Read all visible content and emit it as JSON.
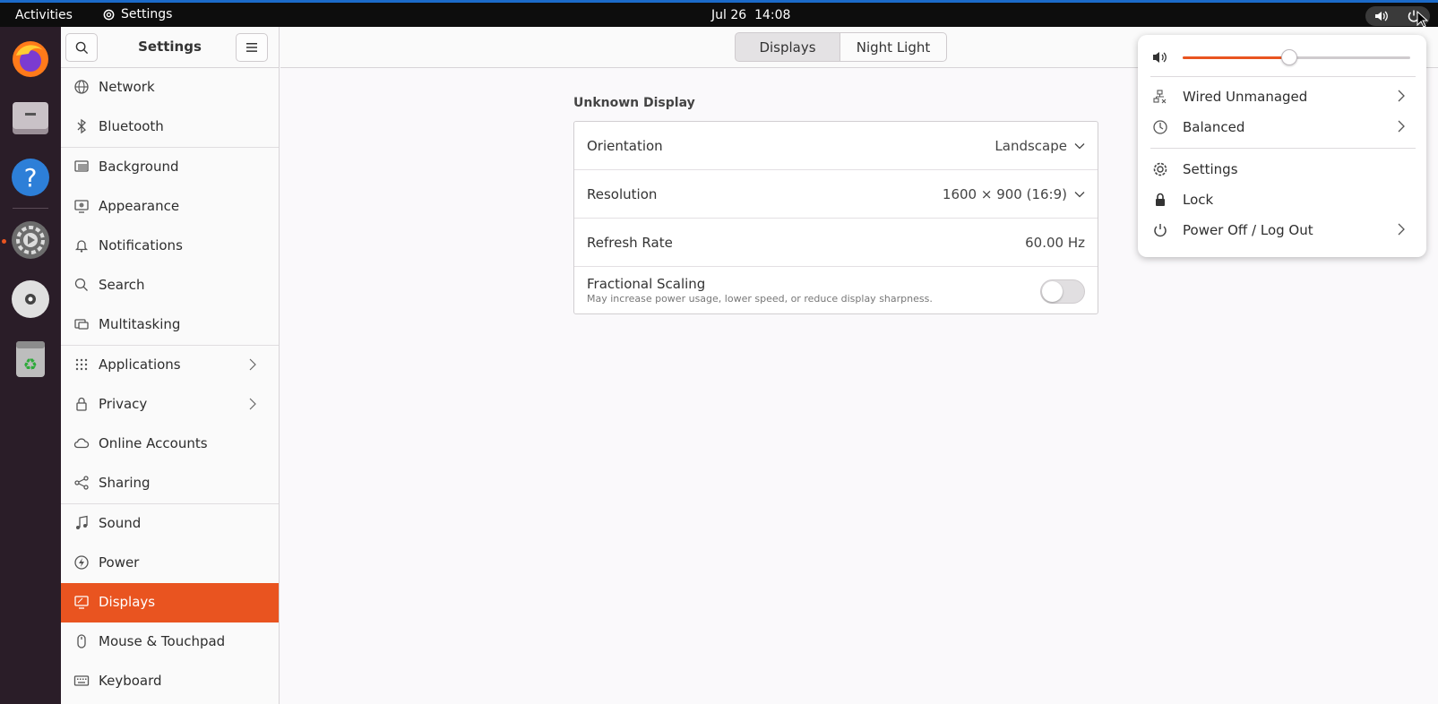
{
  "topbar": {
    "activities": "Activities",
    "app_name": "Settings",
    "date": "Jul 26",
    "time": "14:08"
  },
  "dock": {
    "items": [
      "firefox-icon",
      "files-icon",
      "help-icon",
      "settings-icon",
      "disc-icon",
      "trash-icon"
    ]
  },
  "sidebar": {
    "title": "Settings",
    "items": [
      {
        "label": "Network",
        "icon": "network-icon"
      },
      {
        "label": "Bluetooth",
        "icon": "bluetooth-icon"
      },
      {
        "label": "Background",
        "icon": "background-icon"
      },
      {
        "label": "Appearance",
        "icon": "appearance-icon"
      },
      {
        "label": "Notifications",
        "icon": "bell-icon"
      },
      {
        "label": "Search",
        "icon": "search-icon"
      },
      {
        "label": "Multitasking",
        "icon": "multitasking-icon"
      },
      {
        "label": "Applications",
        "icon": "grid-icon"
      },
      {
        "label": "Privacy",
        "icon": "lock-icon"
      },
      {
        "label": "Online Accounts",
        "icon": "cloud-icon"
      },
      {
        "label": "Sharing",
        "icon": "share-icon"
      },
      {
        "label": "Sound",
        "icon": "music-note-icon"
      },
      {
        "label": "Power",
        "icon": "power-bolt-icon"
      },
      {
        "label": "Displays",
        "icon": "display-icon",
        "active": true
      },
      {
        "label": "Mouse & Touchpad",
        "icon": "mouse-icon"
      },
      {
        "label": "Keyboard",
        "icon": "keyboard-icon"
      }
    ]
  },
  "tabs": {
    "displays": "Displays",
    "night_light": "Night Light"
  },
  "display": {
    "title": "Unknown Display",
    "orientation_label": "Orientation",
    "orientation_value": "Landscape",
    "resolution_label": "Resolution",
    "resolution_value": "1600 × 900 (16:9)",
    "refresh_label": "Refresh Rate",
    "refresh_value": "60.00 Hz",
    "scaling_label": "Fractional Scaling",
    "scaling_sub": "May increase power usage, lower speed, or reduce display sharpness.",
    "scaling_enabled": false
  },
  "quick_menu": {
    "volume_level": 0.47,
    "wired": "Wired Unmanaged",
    "power_mode": "Balanced",
    "settings": "Settings",
    "lock": "Lock",
    "power_off": "Power Off / Log Out"
  },
  "colors": {
    "accent": "#e95420",
    "topbar": "#0d0d0d"
  }
}
